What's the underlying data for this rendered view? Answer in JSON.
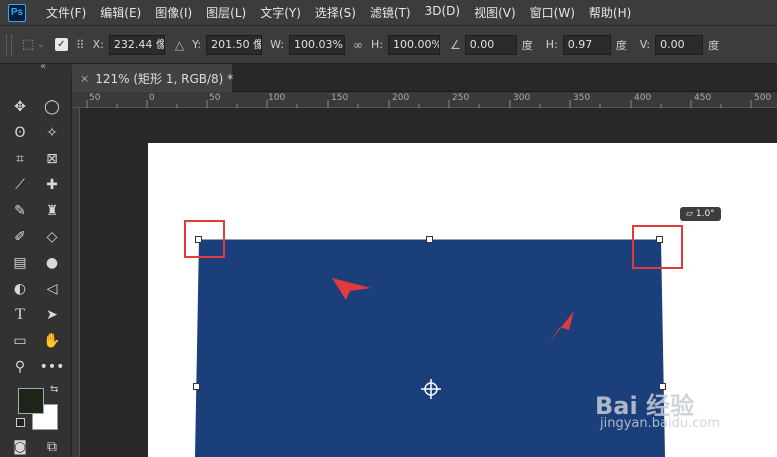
{
  "app": {
    "logo": "Ps"
  },
  "menu": [
    "文件(F)",
    "编辑(E)",
    "图像(I)",
    "图层(L)",
    "文字(Y)",
    "选择(S)",
    "滤镜(T)",
    "3D(D)",
    "视图(V)",
    "窗口(W)",
    "帮助(H)"
  ],
  "options": {
    "x_label": "X:",
    "x_value": "232.44 像素",
    "y_label": "Y:",
    "y_value": "201.50 像素",
    "w_label": "W:",
    "w_value": "100.03%",
    "h_label": "H:",
    "h_value": "100.00%",
    "angle_value": "0.00",
    "angle_unit": "度",
    "hskew_label": "H:",
    "hskew_value": "0.97",
    "hskew_unit": "度",
    "vskew_label": "V:",
    "vskew_value": "0.00",
    "vskew_unit": "度"
  },
  "tab": {
    "title": "121% (矩形 1, RGB/8) *"
  },
  "ruler": {
    "ticks": [
      "50",
      "0",
      "50",
      "100",
      "150",
      "200",
      "250",
      "300",
      "350",
      "400",
      "450",
      "500"
    ]
  },
  "canvas": {
    "shape_color": "#1a3f7a",
    "annotation_color": "#e03a3a",
    "skew_readout": "1.0°"
  },
  "watermark": {
    "brand": "Bai 经验",
    "url": "jingyan.baidu.com"
  },
  "panel": {
    "collapse": "«"
  }
}
